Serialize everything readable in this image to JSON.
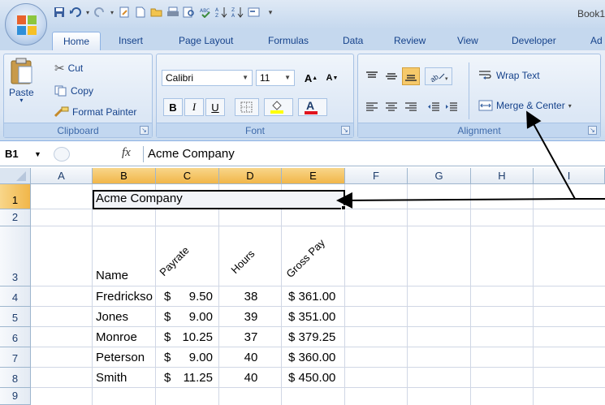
{
  "window": {
    "title": "Book1"
  },
  "tabs": [
    "Home",
    "Insert",
    "Page Layout",
    "Formulas",
    "Data",
    "Review",
    "View",
    "Developer",
    "Ad"
  ],
  "ribbon": {
    "clipboard": {
      "label": "Clipboard",
      "paste": "Paste",
      "cut": "Cut",
      "copy": "Copy",
      "format_painter": "Format Painter"
    },
    "font": {
      "label": "Font",
      "name": "Calibri",
      "size": "11",
      "bold": "B",
      "italic": "I",
      "underline": "U"
    },
    "alignment": {
      "label": "Alignment",
      "wrap_text": "Wrap Text",
      "merge_center": "Merge & Center"
    }
  },
  "formula_bar": {
    "cell_ref": "B1",
    "fx": "fx",
    "value": "Acme Company"
  },
  "columns": [
    "A",
    "B",
    "C",
    "D",
    "E",
    "F",
    "G",
    "H",
    "I"
  ],
  "rows": [
    "1",
    "2",
    "3",
    "4",
    "5",
    "6",
    "7",
    "8",
    "9"
  ],
  "sheet": {
    "title": "Acme Company",
    "headers": {
      "name": "Name",
      "payrate": "Payrate",
      "hours": "Hours",
      "gross": "Gross Pay"
    },
    "records": [
      {
        "name": "Fredrickso",
        "cur": "$",
        "rate": "9.50",
        "hours": "38",
        "gross": "$ 361.00"
      },
      {
        "name": "Jones",
        "cur": "$",
        "rate": "9.00",
        "hours": "39",
        "gross": "$ 351.00"
      },
      {
        "name": "Monroe",
        "cur": "$",
        "rate": "10.25",
        "hours": "37",
        "gross": "$ 379.25"
      },
      {
        "name": "Peterson",
        "cur": "$",
        "rate": "9.00",
        "hours": "40",
        "gross": "$ 360.00"
      },
      {
        "name": "Smith",
        "cur": "$",
        "rate": "11.25",
        "hours": "40",
        "gross": "$ 450.00"
      }
    ]
  },
  "colors": {
    "accent": "#15428b",
    "selected_header": "#f1b649",
    "ribbon": "#dbe6f4"
  }
}
